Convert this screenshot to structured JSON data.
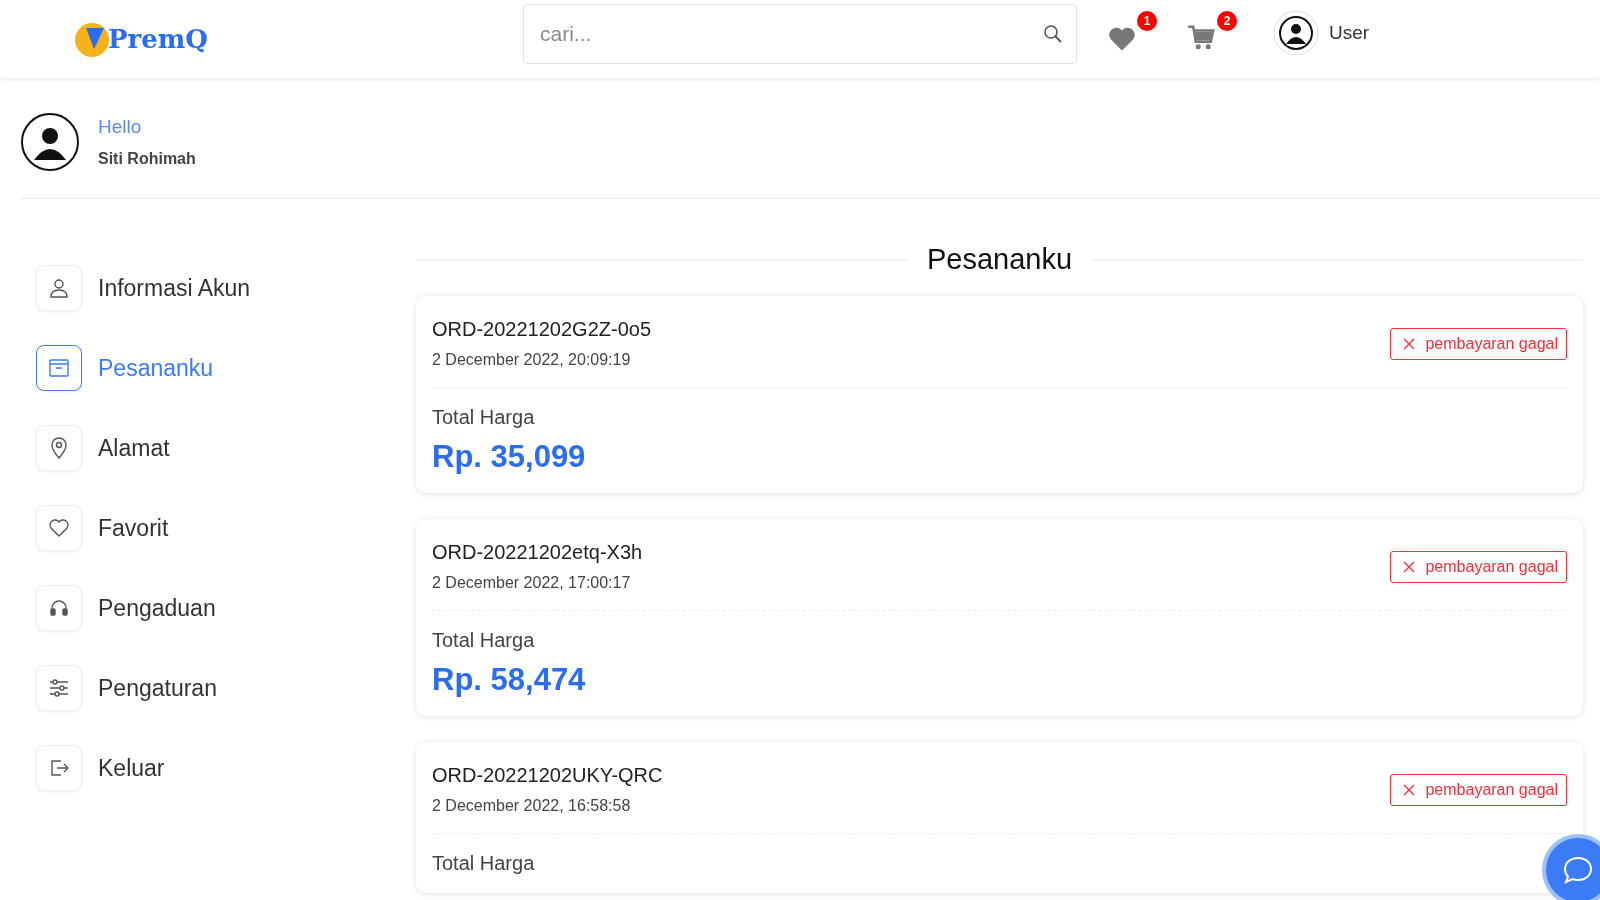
{
  "header": {
    "logo": "PremQ",
    "search": {
      "placeholder": "cari..."
    },
    "wishlist_count": "1",
    "cart_count": "2",
    "user_label": "User"
  },
  "profile": {
    "greeting": "Hello",
    "name": "Siti Rohimah"
  },
  "sidebar": {
    "items": [
      {
        "label": "Informasi Akun",
        "selected": false
      },
      {
        "label": "Pesananku",
        "selected": true
      },
      {
        "label": "Alamat",
        "selected": false
      },
      {
        "label": "Favorit",
        "selected": false
      },
      {
        "label": "Pengaduan",
        "selected": false
      },
      {
        "label": "Pengaturan",
        "selected": false
      },
      {
        "label": "Keluar",
        "selected": false
      }
    ]
  },
  "orders": {
    "title": "Pesananku",
    "items": [
      {
        "id": "ORD-20221202G2Z-0o5",
        "date": "2 December 2022, 20:09:19",
        "status": "pembayaran gagal",
        "total_label": "Total Harga",
        "total": "Rp. 35,099"
      },
      {
        "id": "ORD-20221202etq-X3h",
        "date": "2 December 2022, 17:00:17",
        "status": "pembayaran gagal",
        "total_label": "Total Harga",
        "total": "Rp. 58,474"
      },
      {
        "id": "ORD-20221202UKY-QRC",
        "date": "2 December 2022, 16:58:58",
        "status": "pembayaran gagal",
        "total_label": "Total Harga"
      }
    ]
  }
}
